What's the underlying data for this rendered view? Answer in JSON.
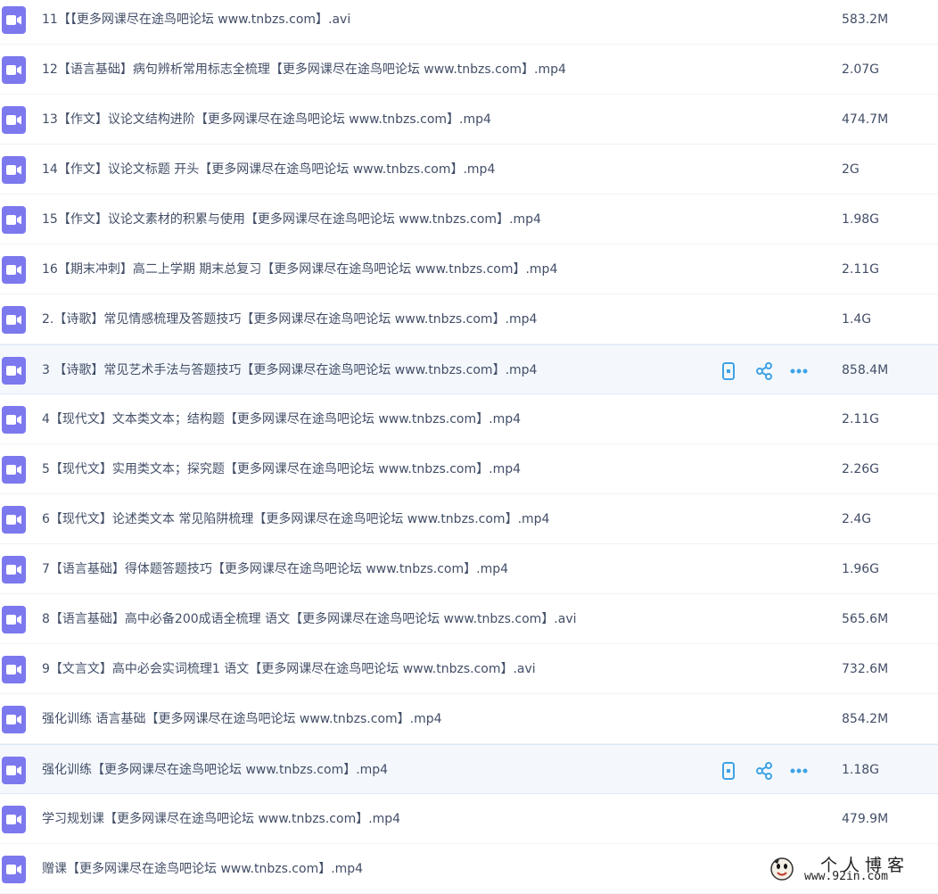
{
  "files": [
    {
      "name": "11【【更多网课尽在途鸟吧论坛 www.tnbzs.com】.avi",
      "size": "583.2M",
      "icon": "video-file-icon"
    },
    {
      "name": "12【语言基础】病句辨析常用标志全梳理【更多网课尽在途鸟吧论坛 www.tnbzs.com】.mp4",
      "size": "2.07G",
      "icon": "video-file-icon"
    },
    {
      "name": "13【作文】议论文结构进阶【更多网课尽在途鸟吧论坛 www.tnbzs.com】.mp4",
      "size": "474.7M",
      "icon": "video-file-icon"
    },
    {
      "name": "14【作文】议论文标题 开头【更多网课尽在途鸟吧论坛 www.tnbzs.com】.mp4",
      "size": "2G",
      "icon": "video-file-icon"
    },
    {
      "name": "15【作文】议论文素材的积累与使用【更多网课尽在途鸟吧论坛 www.tnbzs.com】.mp4",
      "size": "1.98G",
      "icon": "video-file-icon"
    },
    {
      "name": "16【期末冲刺】高二上学期 期末总复习【更多网课尽在途鸟吧论坛 www.tnbzs.com】.mp4",
      "size": "2.11G",
      "icon": "video-file-icon"
    },
    {
      "name": "2.【诗歌】常见情感梳理及答题技巧【更多网课尽在途鸟吧论坛 www.tnbzs.com】.mp4",
      "size": "1.4G",
      "icon": "video-file-icon"
    },
    {
      "name": "3 【诗歌】常见艺术手法与答题技巧【更多网课尽在途鸟吧论坛 www.tnbzs.com】.mp4",
      "size": "858.4M",
      "icon": "video-file-icon",
      "hover": true
    },
    {
      "name": "4【现代文】文本类文本；结构题【更多网课尽在途鸟吧论坛 www.tnbzs.com】.mp4",
      "size": "2.11G",
      "icon": "video-file-icon"
    },
    {
      "name": "5【现代文】实用类文本；探究题【更多网课尽在途鸟吧论坛 www.tnbzs.com】.mp4",
      "size": "2.26G",
      "icon": "video-file-icon"
    },
    {
      "name": "6【现代文】论述类文本 常见陷阱梳理【更多网课尽在途鸟吧论坛 www.tnbzs.com】.mp4",
      "size": "2.4G",
      "icon": "video-file-icon"
    },
    {
      "name": "7【语言基础】得体题答题技巧【更多网课尽在途鸟吧论坛 www.tnbzs.com】.mp4",
      "size": "1.96G",
      "icon": "video-file-icon"
    },
    {
      "name": "8【语言基础】高中必备200成语全梳理 语文【更多网课尽在途鸟吧论坛 www.tnbzs.com】.avi",
      "size": "565.6M",
      "icon": "video-file-icon"
    },
    {
      "name": "9【文言文】高中必会实词梳理1 语文【更多网课尽在途鸟吧论坛 www.tnbzs.com】.avi",
      "size": "732.6M",
      "icon": "video-file-icon"
    },
    {
      "name": "强化训练 语言基础【更多网课尽在途鸟吧论坛 www.tnbzs.com】.mp4",
      "size": "854.2M",
      "icon": "video-file-icon"
    },
    {
      "name": "强化训练【更多网课尽在途鸟吧论坛 www.tnbzs.com】.mp4",
      "size": "1.18G",
      "icon": "video-file-icon",
      "hover": true
    },
    {
      "name": "学习规划课【更多网课尽在途鸟吧论坛 www.tnbzs.com】.mp4",
      "size": "479.9M",
      "icon": "video-file-icon"
    },
    {
      "name": "赠课【更多网课尽在途鸟吧论坛 www.tnbzs.com】.mp4",
      "size": "",
      "icon": "video-file-icon"
    }
  ],
  "row_actions": [
    "phone-icon",
    "share-icon",
    "more-icon"
  ],
  "colors": {
    "file_icon": "#7c78ee",
    "action_icon": "#3fa2e6",
    "text": "#424e67",
    "hover_bg": "#f4f8fd"
  },
  "watermark": {
    "title": "个人博客",
    "url": "www.92in.com"
  }
}
